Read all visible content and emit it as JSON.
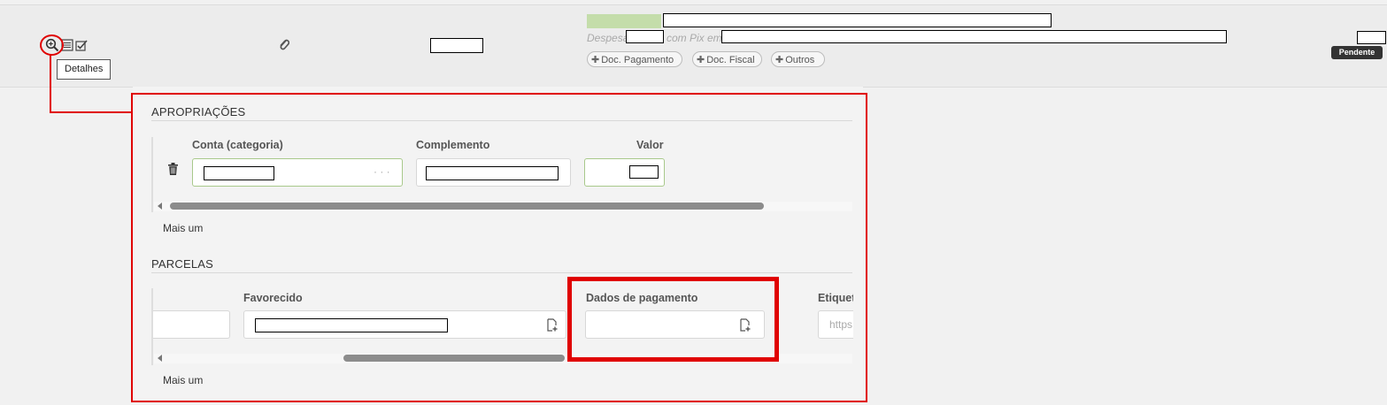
{
  "row": {
    "tooltip": "Detalhes",
    "description_prefix": "Despesa",
    "description_mid": "com Pix em",
    "chips": [
      {
        "label": "Doc. Pagamento"
      },
      {
        "label": "Doc. Fiscal"
      },
      {
        "label": "Outros"
      }
    ],
    "status_badge": "Pendente",
    "icons": [
      "zoom-details-icon",
      "list-icon",
      "edit-check-icon",
      "paperclip-icon"
    ]
  },
  "apropriacoes": {
    "title": "APROPRIAÇÕES",
    "columns": {
      "conta": "Conta (categoria)",
      "complemento": "Complemento",
      "valor": "Valor"
    },
    "conta_ellipsis": "· · ·",
    "add_more": "Mais um"
  },
  "parcelas": {
    "title": "PARCELAS",
    "columns": {
      "favorecido": "Favorecido",
      "dados_pagamento": "Dados de pagamento",
      "etiqueta": "Etiquet"
    },
    "etiqueta_placeholder": "https",
    "add_more": "Mais um"
  },
  "colors": {
    "highlight": "#e00000",
    "accent_green": "#a8c98b",
    "status_dark": "#333333"
  }
}
